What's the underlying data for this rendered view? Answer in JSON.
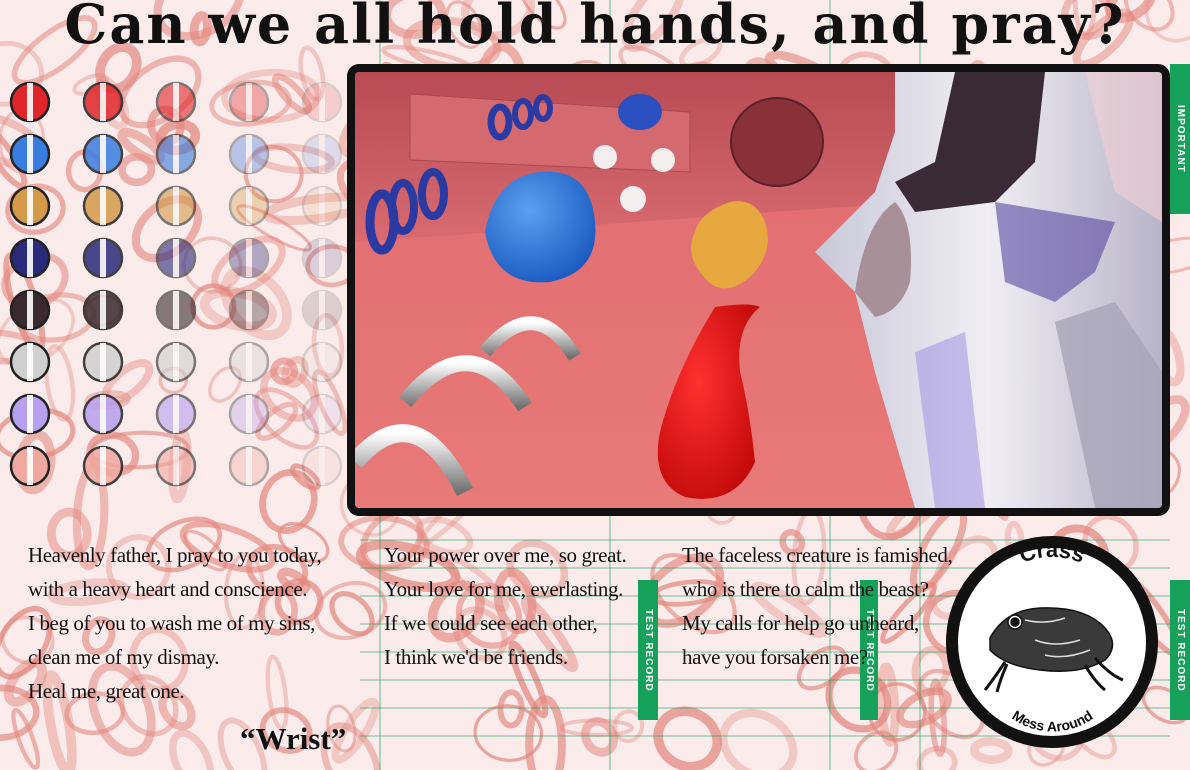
{
  "title": "Can we all hold hands, and pray?",
  "poem": {
    "column1": [
      "Heavenly father, I pray to you today,",
      "with a heavy heart and conscience.",
      "I beg of you to wash me of my sins,",
      "clean me of my dismay.",
      "Heal me, great one."
    ],
    "column2": [
      "Your power over me, so great.",
      "Your love for me, everlasting.",
      "If we could see each other,",
      "I think we'd be friends."
    ],
    "column3": [
      "The faceless creature is famished,",
      "who is there to calm the beast?",
      "My calls for help go unheard,",
      "have you forsaken me?"
    ]
  },
  "artwork_title": "“Wrist”",
  "logo": {
    "top_text": "Crass",
    "bottom_text": "Mess Around",
    "icon": "frog-icon"
  },
  "form_tabs": [
    "IMPORTANT",
    "TEST RECORD",
    "TEST RECORD",
    "TEST RECORD"
  ],
  "palette": {
    "dot_rows": [
      "#e0262a",
      "#3a7de0",
      "#d49a4a",
      "#2a2a7a",
      "#3a2a30",
      "#cfcfcf",
      "#b8a0f0",
      "#f0a8a0"
    ],
    "background_pattern": "#e3877f",
    "form_green": "#16a15b"
  }
}
